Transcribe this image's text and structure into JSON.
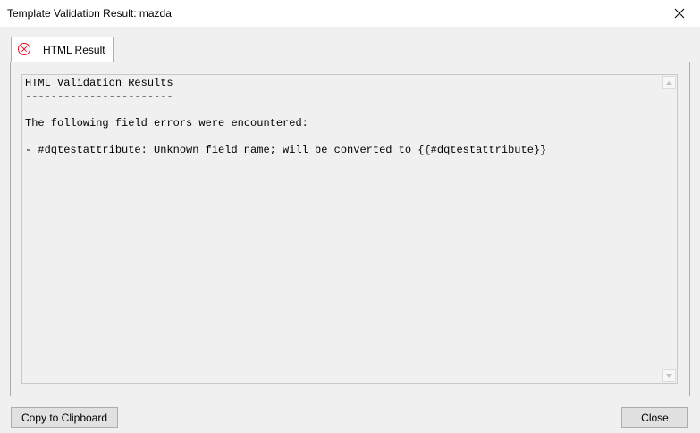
{
  "window": {
    "title": "Template Validation Result: mazda",
    "close_icon": "close-icon"
  },
  "tabs": [
    {
      "label": "HTML Result",
      "icon": "error-circle-icon",
      "icon_color": "#e81123"
    }
  ],
  "result": {
    "text": "HTML Validation Results\n-----------------------\n\nThe following field errors were encountered:\n\n- #dqtestattribute: Unknown field name; will be converted to {{#dqtestattribute}}"
  },
  "buttons": {
    "copy_label": "Copy to Clipboard",
    "close_label": "Close"
  }
}
